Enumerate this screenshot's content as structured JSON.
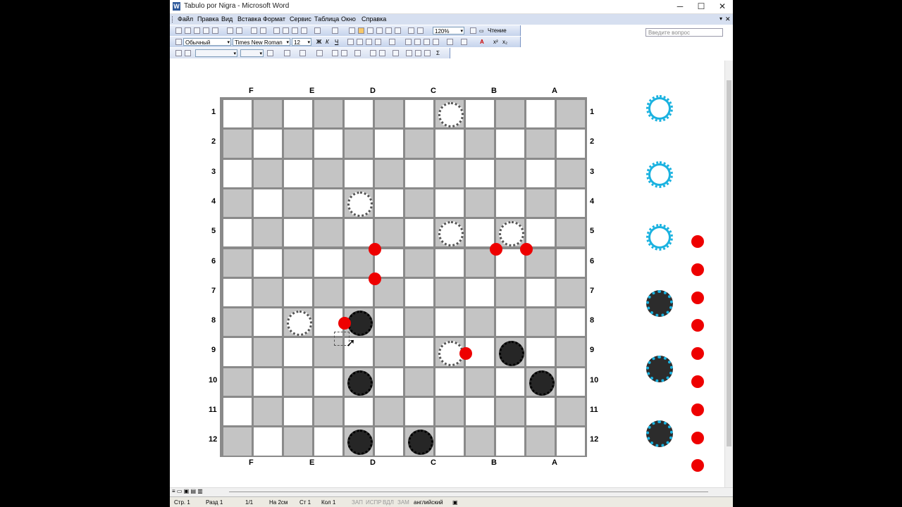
{
  "window": {
    "title": "Tabulo por Nigra - Microsoft Word",
    "app_icon": "W",
    "controls": [
      "─",
      "☐",
      "✕"
    ]
  },
  "menubar": {
    "items": [
      "Файл",
      "Правка",
      "Вид",
      "Вставка",
      "Формат",
      "Сервис",
      "Таблица",
      "Окно",
      "Справка"
    ],
    "ask_placeholder": "Введите вопрос"
  },
  "toolbar": {
    "zoom": "120%",
    "reading_label": "Чтение",
    "style": "Обычный",
    "font": "Times New Roman",
    "size": "12"
  },
  "board": {
    "columns_top": [
      "F",
      "E",
      "D",
      "C",
      "B",
      "A"
    ],
    "columns_bottom": [
      "F",
      "E",
      "D",
      "C",
      "B",
      "A"
    ],
    "rows": [
      "1",
      "2",
      "3",
      "4",
      "5",
      "6",
      "7",
      "8",
      "9",
      "10",
      "11",
      "12"
    ],
    "white_pieces": [
      [
        0,
        7
      ],
      [
        3,
        4
      ],
      [
        4,
        7
      ],
      [
        4,
        9
      ],
      [
        7,
        2
      ],
      [
        8,
        7
      ]
    ],
    "black_pieces": [
      [
        7,
        4
      ],
      [
        8,
        9
      ],
      [
        9,
        4
      ],
      [
        9,
        10
      ],
      [
        11,
        4
      ],
      [
        11,
        6
      ]
    ],
    "red_markers": [
      [
        5,
        5
      ],
      [
        5,
        9
      ],
      [
        5,
        10
      ],
      [
        6,
        5
      ],
      [
        7.5,
        4
      ],
      [
        8.5,
        8
      ]
    ]
  },
  "side_pieces": {
    "white": 3,
    "black": 3,
    "red_markers": 9
  },
  "status": {
    "page": "Стр. 1",
    "section": "Разд 1",
    "pages": "1/1",
    "at": "На 2см",
    "line": "Ст 1",
    "col": "Кол 1",
    "rec": "ЗАП",
    "trk": "ИСПР",
    "ext": "ВДЛ",
    "ovr": "ЗАМ",
    "language": "английский"
  },
  "colors": {
    "accent_piece": "#1ab2e0",
    "red_marker": "#ee0000",
    "menubar": "#d6dff0"
  }
}
